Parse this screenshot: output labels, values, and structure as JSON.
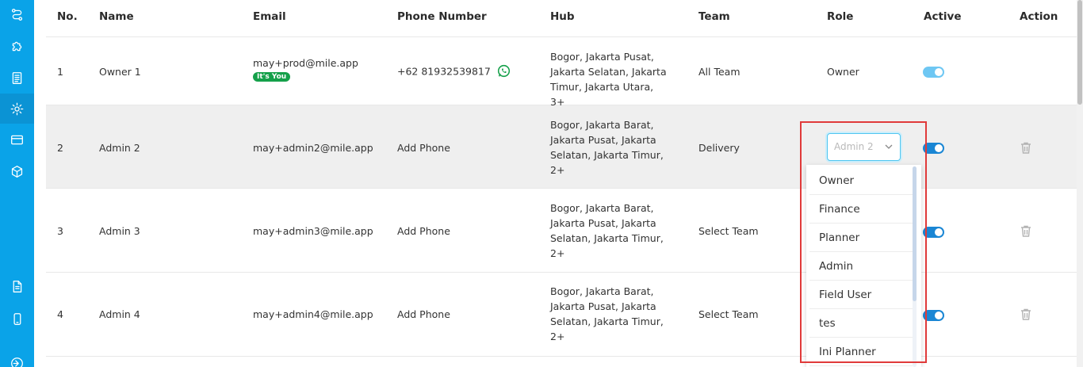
{
  "sidebar": {
    "icons": [
      "route-icon",
      "puzzle-icon",
      "document-icon",
      "gear-icon",
      "card-icon",
      "box-icon",
      "report-icon",
      "mobile-icon",
      "logout-icon"
    ]
  },
  "table": {
    "headers": [
      "No.",
      "Name",
      "Email",
      "Phone Number",
      "Hub",
      "Team",
      "Role",
      "Active",
      "Action"
    ],
    "rows": [
      {
        "no": "1",
        "name": "Owner 1",
        "email": "may+prod@mile.app",
        "badge": "It's You",
        "phone": "+62 81932539817",
        "hub": "Bogor, Jakarta Pusat, Jakarta Selatan, Jakarta Timur, Jakarta Utara, 3+",
        "team": "All Team",
        "role": "Owner"
      },
      {
        "no": "2",
        "name": "Admin 2",
        "email": "may+admin2@mile.app",
        "phone": "Add Phone",
        "hub": "Bogor, Jakarta Barat, Jakarta Pusat, Jakarta Selatan, Jakarta Timur, 2+",
        "team": "Delivery",
        "role": "Admin 2"
      },
      {
        "no": "3",
        "name": "Admin 3",
        "email": "may+admin3@mile.app",
        "phone": "Add Phone",
        "hub": "Bogor, Jakarta Barat, Jakarta Pusat, Jakarta Selatan, Jakarta Timur, 2+",
        "team": "Select Team"
      },
      {
        "no": "4",
        "name": "Admin 4",
        "email": "may+admin4@mile.app",
        "phone": "Add Phone",
        "hub": "Bogor, Jakarta Barat, Jakarta Pusat, Jakarta Selatan, Jakarta Timur, 2+",
        "team": "Select Team"
      }
    ]
  },
  "role_dropdown": {
    "selected": "Admin 2",
    "options": [
      "Owner",
      "Finance",
      "Planner",
      "Admin",
      "Field User",
      "tes",
      "Ini Planner"
    ]
  },
  "colors": {
    "sidebar": "#0aa3e8",
    "accent": "#1a86d4",
    "badge": "#15a04a",
    "highlight_box": "#e03a3a"
  }
}
